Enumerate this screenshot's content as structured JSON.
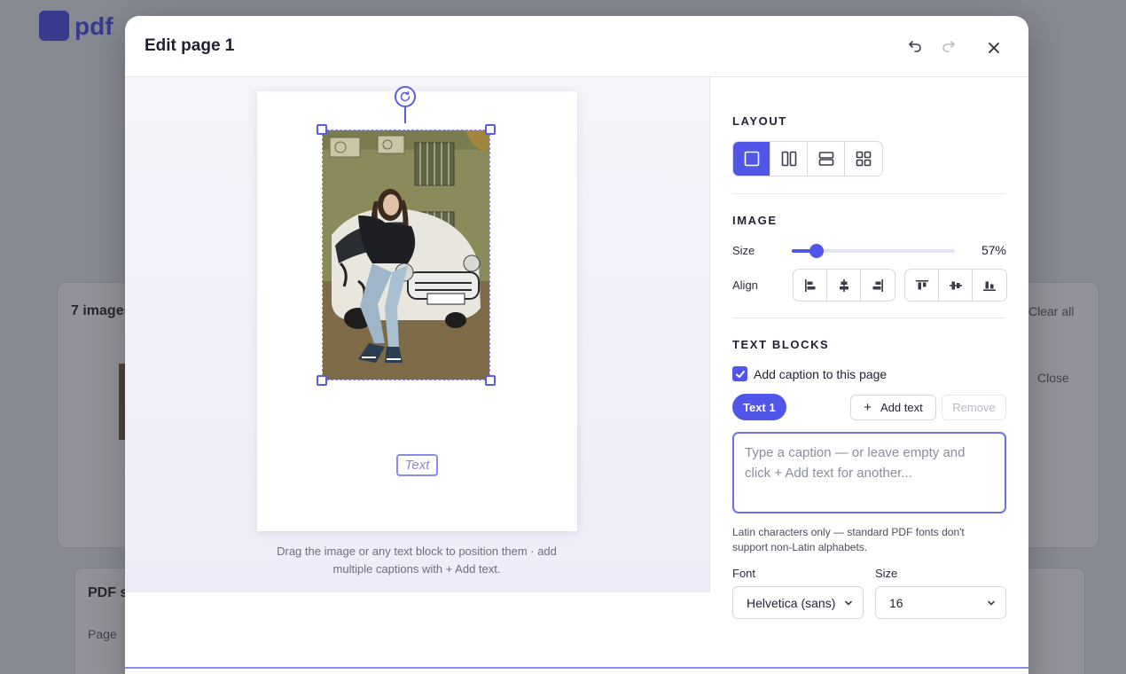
{
  "background": {
    "logo_text": "pdf",
    "card_title": "7 images",
    "card2_title": "PDF s",
    "card2_sub": "Page",
    "side_text_1": "Clear all",
    "side_text_2": "Close"
  },
  "modal": {
    "title": "Edit page 1",
    "undo_icon": "undo-icon",
    "redo_icon": "redo-icon",
    "close_icon": "close-icon"
  },
  "canvas": {
    "text_block": "Text",
    "hint": "Drag the image or any text block to position them · add multiple captions with + Add text."
  },
  "panel": {
    "layout": {
      "title": "LAYOUT",
      "options": [
        "single",
        "two-columns",
        "two-rows",
        "grid-2x2"
      ],
      "selected": "single"
    },
    "image": {
      "title": "IMAGE",
      "size_label": "Size",
      "size_value": "57%",
      "size_fraction": 0.57,
      "align_label": "Align",
      "h_align": [
        "left",
        "center",
        "right"
      ],
      "v_align": [
        "top",
        "middle",
        "bottom"
      ]
    },
    "text_blocks": {
      "title": "TEXT BLOCKS",
      "caption_checkbox_label": "Add caption to this page",
      "caption_checked": true,
      "active_tab": "Text 1",
      "add_text_label": "Add text",
      "remove_label": "Remove",
      "caption_placeholder": "Type a caption — or leave empty and click + Add text for another...",
      "caption_value": "",
      "note": "Latin characters only — standard PDF fonts don't support non-Latin alphabets.",
      "font_label": "Font",
      "font_value": "Helvetica (sans)",
      "size_label": "Size",
      "size_value": "16"
    }
  },
  "colors": {
    "accent": "#5156e8",
    "selection": "#5b5ce6"
  }
}
